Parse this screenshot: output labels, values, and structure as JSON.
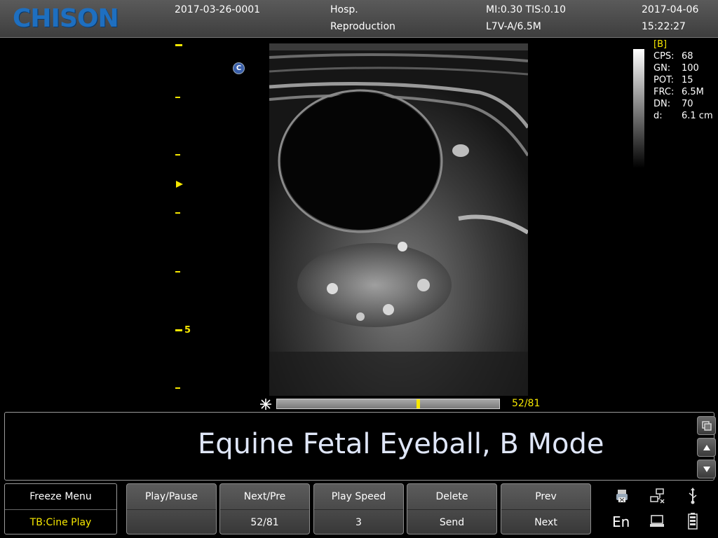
{
  "header": {
    "brand": "CHISON",
    "patient_id": "2017-03-26-0001",
    "hospital": "Hosp.",
    "exam": "Reproduction",
    "mi_tis": "MI:0.30  TIS:0.10",
    "probe": "L7V-A/6.5M",
    "date": "2017-04-06",
    "time": "15:22:27"
  },
  "scale": {
    "depth_label": "5"
  },
  "orientation": {
    "badge": "C"
  },
  "params": {
    "mode": "[B]",
    "rows": [
      {
        "k": "CPS:",
        "v": "68"
      },
      {
        "k": "GN:",
        "v": "100"
      },
      {
        "k": "POT:",
        "v": "15"
      },
      {
        "k": "FRC:",
        "v": "6.5M"
      },
      {
        "k": "DN:",
        "v": "70"
      },
      {
        "k": "d:",
        "v": "6.1 cm"
      }
    ]
  },
  "cine": {
    "count": "52/81",
    "frame": 52,
    "total": 81
  },
  "comment": {
    "text": "Equine Fetal Eyeball, B Mode"
  },
  "menu": {
    "title": "Freeze Menu",
    "tb": "TB:Cine Play"
  },
  "softkeys": [
    {
      "top": "Play/Pause",
      "bottom": ""
    },
    {
      "top": "Next/Pre",
      "bottom": "52/81"
    },
    {
      "top": "Play Speed",
      "bottom": "3"
    },
    {
      "top": "Delete",
      "bottom": "Send"
    },
    {
      "top": "Prev",
      "bottom": "Next"
    }
  ],
  "system": {
    "language": "En"
  },
  "colors": {
    "accent": "#f6e700",
    "brand": "#1e6fc0",
    "comment": "#dfe6f8"
  }
}
